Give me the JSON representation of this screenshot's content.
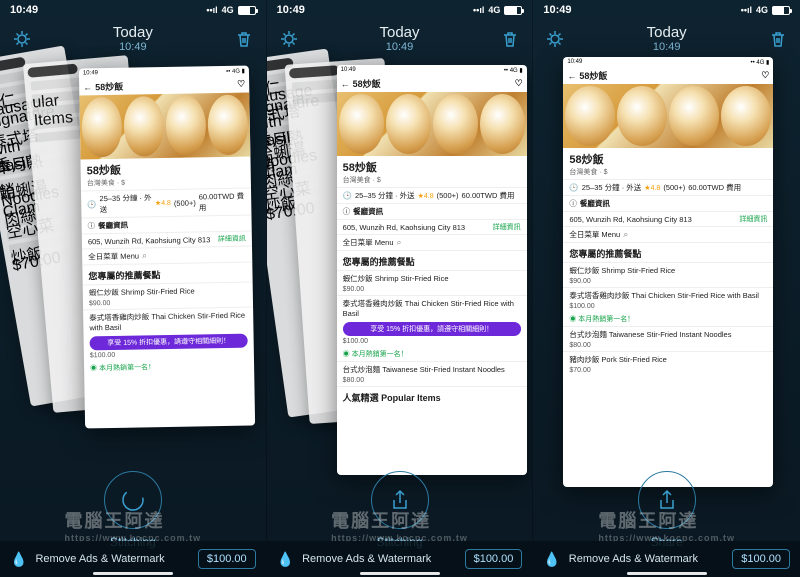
{
  "status_time": "10:49",
  "status_net": "4G",
  "app_title": "Today",
  "app_subtitle": "10:49",
  "action_stitching": "Stitching",
  "action_share": "Share",
  "banner_text": "Remove Ads & Watermark",
  "banner_price": "$100.00",
  "watermark_main": "電腦王阿達",
  "watermark_sub": "https://www.kocpc.com.tw",
  "card": {
    "status_time": "10:49",
    "back_label": "58炒飯",
    "pill": "您專屬的推薦",
    "title": "58炒飯",
    "meta": "台灣美食 · $",
    "eta": "25–35 分鐘 · 外送",
    "rating": "4.8",
    "rating_count": "(500+)",
    "fee": "60.00TWD 費用",
    "info_h": "餐廳資訊",
    "address": "605, Wunzih Rd, Kaohsiung City 813",
    "detail_link": "詳細資訊",
    "menu_h": "全日菜單 Menu",
    "recommend_h": "您專屬的推薦餐點",
    "item1": "蝦仁炒飯 Shrimp Stir-Fried Rice",
    "item1_price": "$90.00",
    "item2": "泰式塔香雞肉炒飯 Thai Chicken Stir-Fried Rice with Basil",
    "item2_price": "$100.00",
    "promo": "享受 15% 折扣優惠，請遵守相關細則！",
    "bestseller": "本月熱銷第一名！",
    "item3": "台式炒泡麵 Taiwanese Stir-Fried Instant Noodles",
    "item3_price": "$80.00",
    "popular_h": "人氣精選 Popular Items",
    "item4": "豬肉炒飯 Pork Stir-Fried Rice",
    "item4_price": "$70.00"
  },
  "ghost": {
    "signature": "蝦仁 Signature",
    "sausage": "Sausage",
    "thai": "泰式塔香",
    "basil": "with Basil",
    "best": "本月熱銷",
    "clam": "蛤蜊湯 Clam",
    "noodles": "Noodles",
    "meat": "肉絲",
    "empty": "空心菜",
    "fried": "炒飯",
    "p70": "$70.00",
    "popular": "ular Items"
  }
}
